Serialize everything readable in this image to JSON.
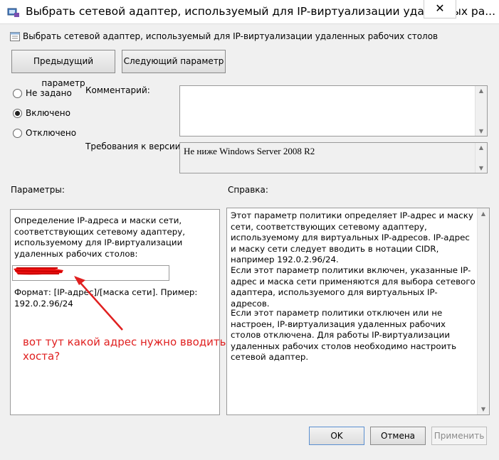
{
  "window": {
    "title": "Выбрать сетевой адаптер, используемый для IP-виртуализации удаленных ра...",
    "close_glyph": "✕"
  },
  "header": {
    "subtitle": "Выбрать сетевой адаптер, используемый для IP-виртуализации удаленных рабочих столов"
  },
  "nav": {
    "prev_label": "Предыдущий параметр",
    "next_label": "Следующий параметр"
  },
  "state": {
    "options": [
      "Не задано",
      "Включено",
      "Отключено"
    ],
    "selected": "Включено"
  },
  "comment": {
    "label": "Комментарий:",
    "value": ""
  },
  "version": {
    "label": "Требования к версии:",
    "value": "Не ниже Windows Server 2008 R2"
  },
  "params": {
    "label": "Параметры:",
    "description": "Определение IP-адреса и маски сети, соответствующих сетевому адаптеру, используемому для IP-виртуализации удаленных рабочих столов:",
    "input_value": "",
    "format_hint": "Формат: [IP-адрес]/[маска сети]. Пример: 192.0.2.96/24"
  },
  "help": {
    "label": "Справка:",
    "paragraphs": [
      "Этот параметр политики определяет IP-адрес и маску сети, соответствующих сетевому адаптеру, используемому для виртуальных IP-адресов. IP-адрес и маску сети следует вводить в нотации CIDR, например 192.0.2.96/24.",
      "Если этот параметр политики включен, указанные IP-адрес и маска сети применяются для выбора сетевого адаптера, используемого для виртуальных IP-адресов.",
      "Если этот параметр политики отключен или не настроен, IP-виртуализация удаленных рабочих столов отключена. Для работы IP-виртуализации удаленных рабочих столов необходимо настроить сетевой адаптер."
    ]
  },
  "annotation": {
    "line1": "вот тут какой адрес нужно вводить",
    "line2": "хоста?",
    "color": "#e02020"
  },
  "footer": {
    "ok_label": "OK",
    "cancel_label": "Отмена",
    "apply_label": "Применить"
  },
  "icons": {
    "window": "policy-window-icon",
    "subtitle": "policy-setting-icon",
    "scroll_up": "▲",
    "scroll_down": "▼"
  }
}
